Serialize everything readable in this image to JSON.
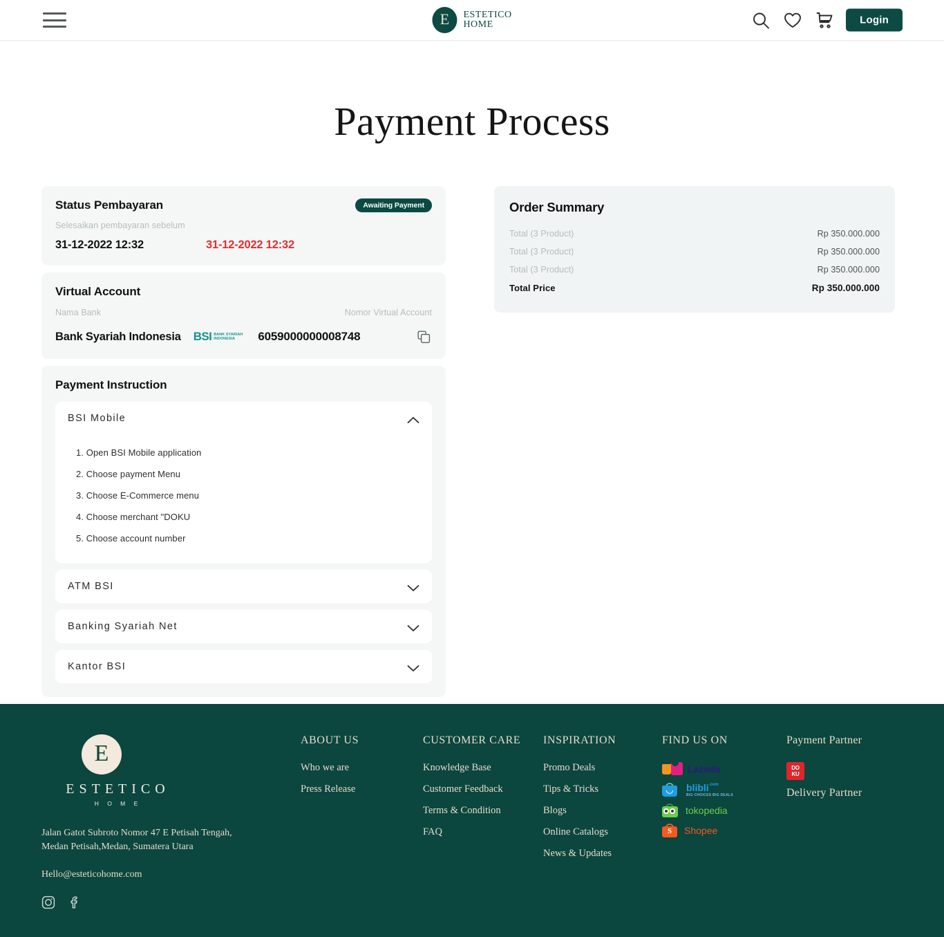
{
  "header": {
    "menu_icon": "hamburger-icon",
    "brand_mark": "E",
    "brand_line1": "ESTETICO",
    "brand_line2": "HOME",
    "search_icon": "search-icon",
    "wishlist_icon": "heart-icon",
    "cart_icon": "cart-icon",
    "login_label": "Login"
  },
  "page": {
    "title": "Payment Process"
  },
  "status": {
    "title": "Status Pembayaran",
    "badge": "Awaiting Payment",
    "subtitle": "Selesaikan pembayaran sebelum",
    "date_primary": "31-12-2022 12:32",
    "date_secondary": "31-12-2022 12:32",
    "badge_color": "#0b4a42",
    "secondary_color": "#e03030"
  },
  "virtual_account": {
    "title": "Virtual Account",
    "label_bank": "Nama Bank",
    "label_number": "Nomor Virtual Account",
    "bank_name": "Bank Syariah Indonesia",
    "bank_logo_mark": "BSI",
    "bank_logo_sub_line1": "BANK SYARIAH",
    "bank_logo_sub_line2": "INDONESIA",
    "account_number": "6059000000008748",
    "copy_icon": "copy-icon"
  },
  "payment_instruction": {
    "title": "Payment Instruction",
    "items": [
      {
        "label": "BSI Mobile",
        "expanded": true,
        "chevron_icon": "chevron-up-icon",
        "steps": [
          "1. Open BSI Mobile application",
          "2. Choose payment Menu",
          "3. Choose E-Commerce menu",
          "4. Choose merchant \"DOKU",
          "5. Choose account number"
        ]
      },
      {
        "label": "ATM BSI",
        "expanded": false,
        "chevron_icon": "chevron-down-icon",
        "steps": []
      },
      {
        "label": "Banking Syariah Net",
        "expanded": false,
        "chevron_icon": "chevron-down-icon",
        "steps": []
      },
      {
        "label": "Kantor BSI",
        "expanded": false,
        "chevron_icon": "chevron-down-icon",
        "steps": []
      }
    ]
  },
  "order_summary": {
    "title": "Order Summary",
    "rows": [
      {
        "label": "Total (3 Product)",
        "value": "Rp 350.000.000"
      },
      {
        "label": "Total (3 Product)",
        "value": "Rp 350.000.000"
      },
      {
        "label": "Total (3 Product)",
        "value": "Rp 350.000.000"
      }
    ],
    "total_label": "Total Price",
    "total_value": "Rp 350.000.000"
  },
  "footer": {
    "background": "#0b463f",
    "brand_mark": "E",
    "brand_name": "ESTETICO",
    "brand_sub": "H O M E",
    "address_line1": "Jalan Gatot Subroto Nomor 47 E Petisah Tengah,",
    "address_line2": "Medan Petisah,Medan, Sumatera Utara",
    "email": "Hello@esteticohome.com",
    "social": [
      {
        "name": "instagram-icon"
      },
      {
        "name": "facebook-icon"
      }
    ],
    "columns": [
      {
        "heading": "ABOUT US",
        "links": [
          "Who we are",
          "Press Release"
        ]
      },
      {
        "heading": "CUSTOMER CARE",
        "links": [
          "Knowledge Base",
          "Customer Feedback",
          "Terms & Condition",
          "FAQ"
        ]
      },
      {
        "heading": "INSPIRATION",
        "links": [
          "Promo Deals",
          "Tips & Tricks",
          "Blogs",
          "Online Catalogs",
          "News & Updates"
        ]
      }
    ],
    "find_us": {
      "heading": "FIND US ON",
      "marketplaces": [
        {
          "name": "Lazada",
          "color": "#2b1c7a"
        },
        {
          "name": "blibli",
          "sub": "BIG CHOICES  BIG DEALS",
          "color": "#1f9ee0",
          "suffix": ".com"
        },
        {
          "name": "tokopedia",
          "color": "#6ccf4b"
        },
        {
          "name": "Shopee",
          "color": "#f4591f"
        }
      ]
    },
    "payment_partner": {
      "heading": "Payment Partner",
      "logo_line1": "DO",
      "logo_line2": "KU",
      "logo_color": "#e0252a",
      "delivery_heading": "Delivery Partner"
    }
  }
}
